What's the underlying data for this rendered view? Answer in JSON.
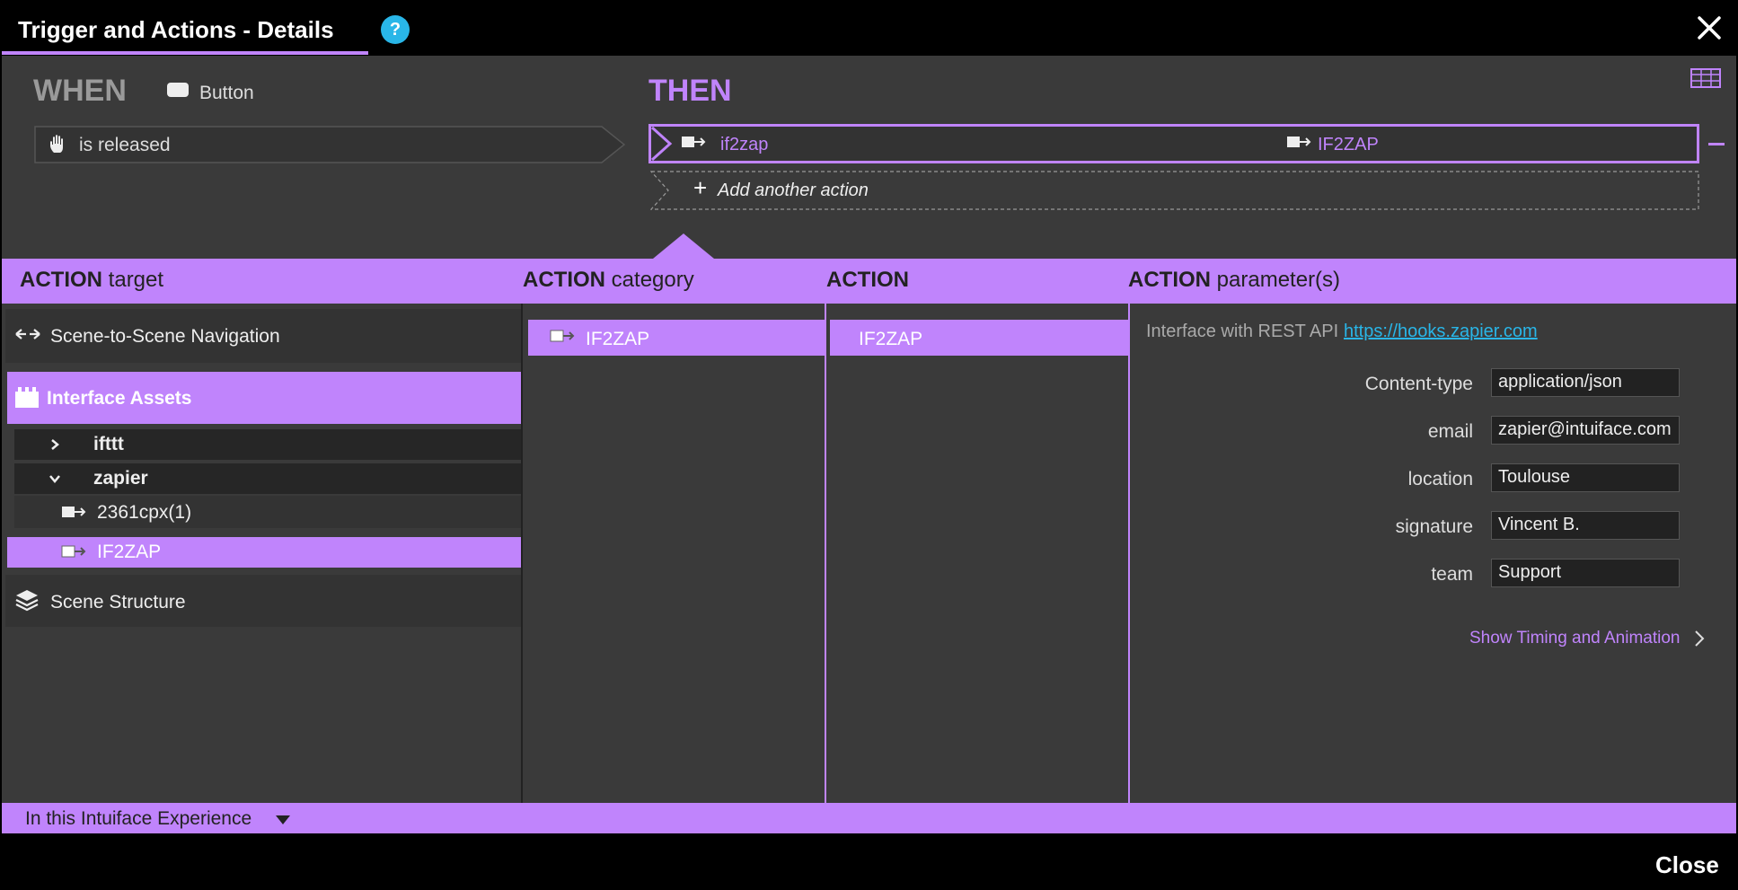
{
  "window": {
    "title": "Trigger and Actions - Details",
    "help": "?"
  },
  "when": {
    "heading": "WHEN",
    "source_label": "Button",
    "trigger_label": "is released"
  },
  "then": {
    "heading": "THEN",
    "action_name": "if2zap",
    "action_target": "IF2ZAP",
    "add_action": "Add another action"
  },
  "headers": {
    "target": {
      "strong": "ACTION",
      "light": "target"
    },
    "category": {
      "strong": "ACTION",
      "light": "category"
    },
    "action": {
      "strong": "ACTION",
      "light": ""
    },
    "params": {
      "strong": "ACTION",
      "light": "parameter(s)"
    }
  },
  "targets": {
    "scene_nav": "Scene-to-Scene Navigation",
    "interface_assets": "Interface Assets",
    "ifttt": "ifttt",
    "zapier": "zapier",
    "item1": "2361cpx(1)",
    "item2": "IF2ZAP",
    "scene_structure": "Scene Structure"
  },
  "category": {
    "selected": "IF2ZAP"
  },
  "action": {
    "selected": "IF2ZAP"
  },
  "params": {
    "description": "Interface with REST API",
    "link": "https://hooks.zapier.com",
    "fields": [
      {
        "label": "Content-type",
        "value": "application/json"
      },
      {
        "label": "email",
        "value": "zapier@intuiface.com"
      },
      {
        "label": "location",
        "value": "Toulouse"
      },
      {
        "label": "signature",
        "value": "Vincent B."
      },
      {
        "label": "team",
        "value": "Support"
      }
    ],
    "timing_link": "Show Timing and Animation"
  },
  "footer": {
    "scope": "In this Intuiface Experience"
  },
  "bottom": {
    "close": "Close"
  },
  "colors": {
    "accent": "#c084fc",
    "panel": "#3a3a3a",
    "chrome": "#000000",
    "link": "#29b6e8"
  }
}
